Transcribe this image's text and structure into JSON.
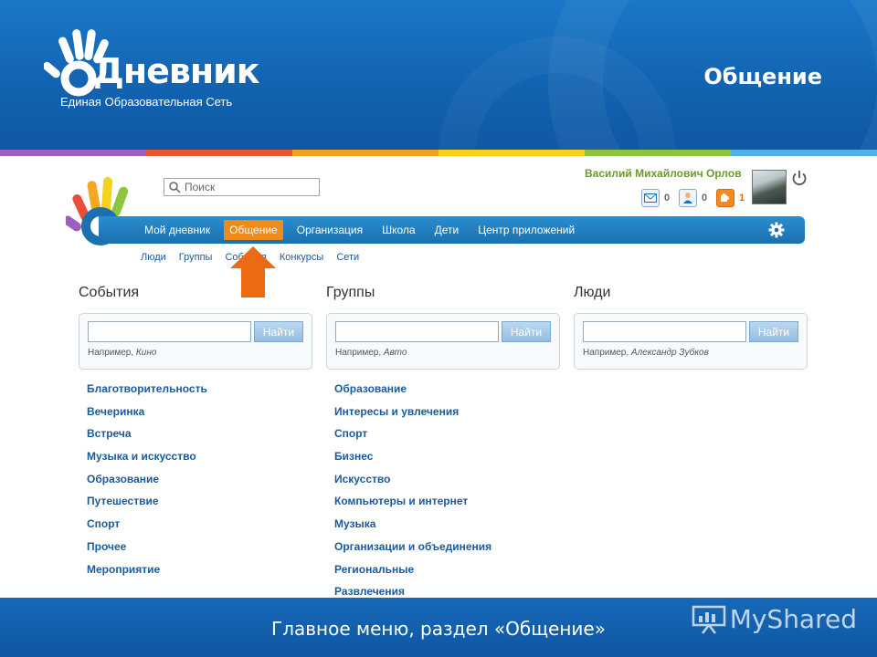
{
  "header": {
    "logo_word": "Дневник",
    "logo_subtitle": "Единая Образовательная Сеть",
    "slide_title": "Общение",
    "strip_colors": [
      "#9b5fc0",
      "#e4572e",
      "#f4a11d",
      "#f7d21c",
      "#8cc63f",
      "#4fb3e8"
    ]
  },
  "site": {
    "search_placeholder": "Поиск",
    "user_name": "Василий Михайлович Орлов",
    "notifications": {
      "messages": "0",
      "friends": "0",
      "applications": "1"
    }
  },
  "nav": {
    "items": [
      "Мой дневник",
      "Общение",
      "Организация",
      "Школа",
      "Дети",
      "Центр приложений"
    ],
    "active": "Общение"
  },
  "subnav": {
    "items": [
      "Люди",
      "Группы",
      "События",
      "Конкурсы",
      "Сети"
    ]
  },
  "columns": [
    {
      "title": "События",
      "button": "Найти",
      "hint_prefix": "Например,",
      "hint_example": "Кино",
      "items": [
        "Благотворительность",
        "Вечеринка",
        "Встреча",
        "Музыка и искусство",
        "Образование",
        "Путешествие",
        "Спорт",
        "Прочее",
        "Мероприятие"
      ]
    },
    {
      "title": "Группы",
      "button": "Найти",
      "hint_prefix": "Например,",
      "hint_example": "Авто",
      "items": [
        "Образование",
        "Интересы и увлечения",
        "Спорт",
        "Бизнес",
        "Искусство",
        "Компьютеры и интернет",
        "Музыка",
        "Организации и объединения",
        "Региональные",
        "Развлечения"
      ]
    },
    {
      "title": "Люди",
      "button": "Найти",
      "hint_prefix": "Например,",
      "hint_example": "Александр Зубков",
      "items": []
    }
  ],
  "footer": {
    "caption": "Главное меню, раздел «Общение»",
    "watermark": "MyShared"
  },
  "colors": {
    "accent_orange": "#f08a1a",
    "nav_blue": "#1a70b0",
    "link_blue": "#1a5a9e",
    "user_green": "#6b9b2a"
  }
}
